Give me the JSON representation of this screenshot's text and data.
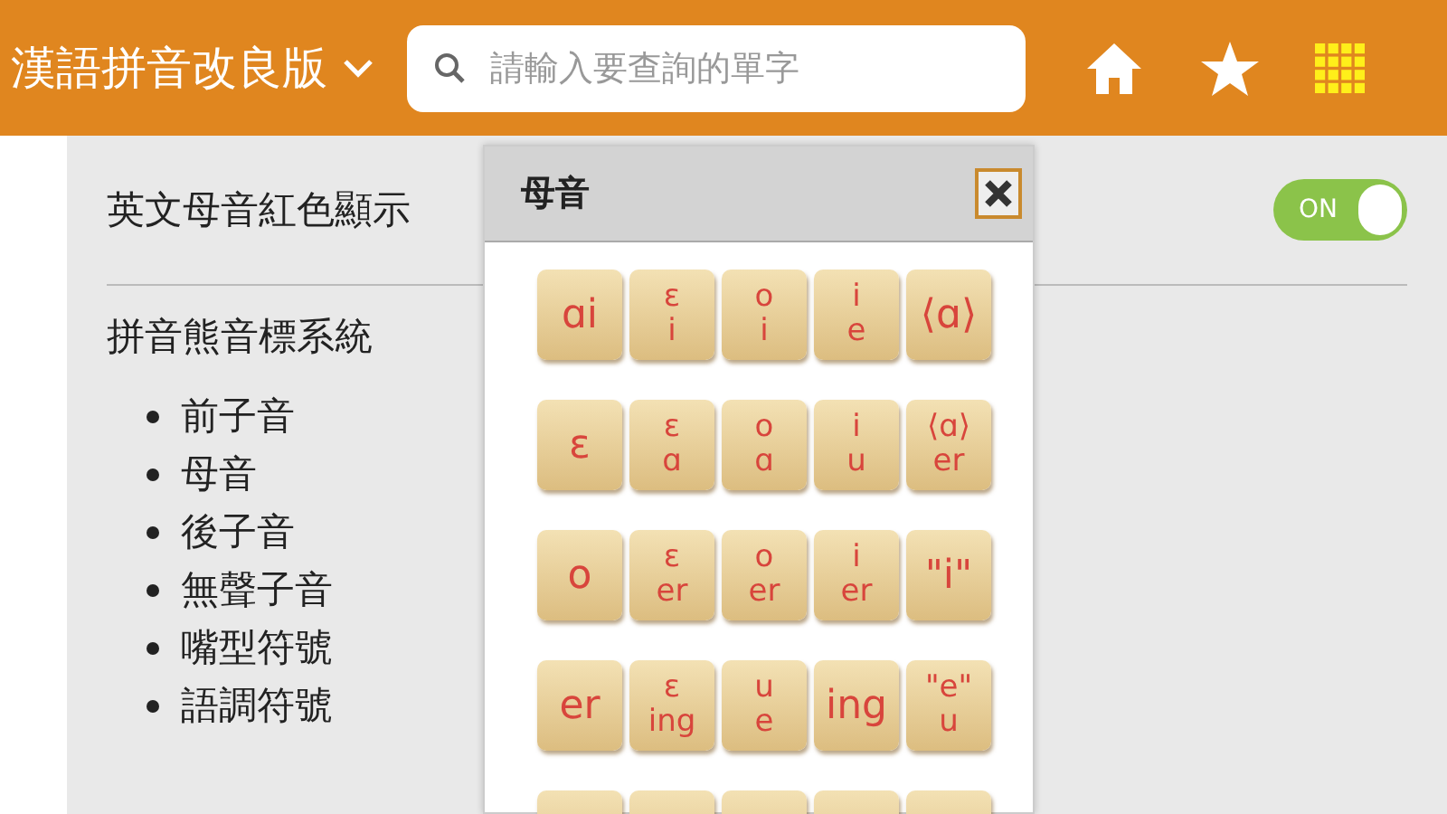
{
  "header": {
    "title": "漢語拼音改良版",
    "search": {
      "placeholder": "請輸入要查詢的單字"
    }
  },
  "settings": [
    {
      "kind": "toggle",
      "label": "英文母音紅色顯示",
      "on": true,
      "state_label": "ON"
    },
    {
      "kind": "list",
      "label": "拼音熊音標系統",
      "items": [
        "前子音",
        "母音",
        "後子音",
        "無聲子音",
        "嘴型符號",
        "語調符號"
      ]
    }
  ],
  "popup": {
    "title": "母音",
    "tiles": [
      {
        "kind": "single",
        "label": "ɑi"
      },
      {
        "kind": "stacked",
        "top": "ɛ",
        "bottom": "i"
      },
      {
        "kind": "stacked",
        "top": "o",
        "bottom": "i"
      },
      {
        "kind": "stacked",
        "top": "i",
        "bottom": "e"
      },
      {
        "kind": "single",
        "label": "⟨ɑ⟩"
      },
      {
        "kind": "single",
        "label": "ɛ"
      },
      {
        "kind": "stacked",
        "top": "ɛ",
        "bottom": "ɑ"
      },
      {
        "kind": "stacked",
        "top": "o",
        "bottom": "ɑ"
      },
      {
        "kind": "stacked",
        "top": "i",
        "bottom": "u"
      },
      {
        "kind": "stacked",
        "top": "⟨ɑ⟩",
        "bottom": "er"
      },
      {
        "kind": "single",
        "label": "o"
      },
      {
        "kind": "stacked",
        "top": "ɛ",
        "bottom": "er"
      },
      {
        "kind": "stacked",
        "top": "o",
        "bottom": "er"
      },
      {
        "kind": "stacked",
        "top": "i",
        "bottom": "er"
      },
      {
        "kind": "single",
        "label": "\"i\""
      },
      {
        "kind": "single",
        "label": "er"
      },
      {
        "kind": "stacked",
        "top": "ɛ",
        "bottom": "ing"
      },
      {
        "kind": "stacked",
        "top": "u",
        "bottom": "e"
      },
      {
        "kind": "single",
        "label": "ing"
      },
      {
        "kind": "stacked",
        "top": "\"e\"",
        "bottom": "u"
      },
      {
        "kind": "blank"
      },
      {
        "kind": "blank"
      },
      {
        "kind": "blank"
      },
      {
        "kind": "blank"
      },
      {
        "kind": "blank"
      }
    ]
  }
}
